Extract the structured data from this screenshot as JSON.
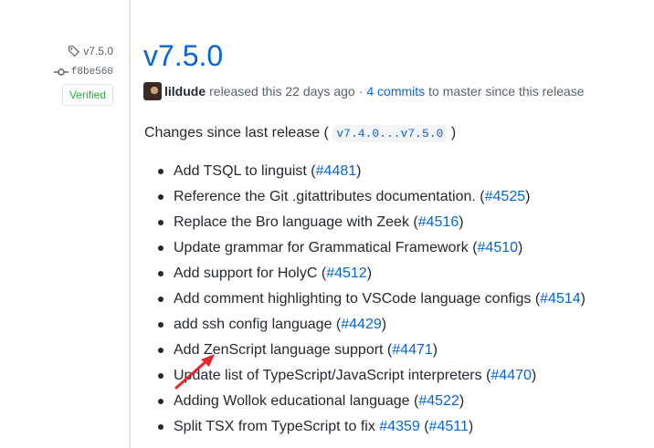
{
  "release": {
    "tag": "v7.5.0",
    "commit": "f8be560",
    "verified": "Verified",
    "title": "v7.5.0",
    "author": "lildude",
    "released_text": "released this 22 days ago",
    "separator": "·",
    "commits_link": "4 commits",
    "commits_suffix": "to master since this release",
    "changes_prefix": "Changes since last release (",
    "compare_range": "v7.4.0...v7.5.0",
    "changes_suffix": ")"
  },
  "changes": [
    {
      "text": "Add TSQL to linguist (",
      "issue": "#4481",
      "close": ")"
    },
    {
      "text": "Reference the Git .gitattributes documentation. (",
      "issue": "#4525",
      "close": ")"
    },
    {
      "text": "Replace the Bro language with Zeek (",
      "issue": "#4516",
      "close": ")"
    },
    {
      "text": "Update grammar for Grammatical Framework (",
      "issue": "#4510",
      "close": ")"
    },
    {
      "text": "Add support for HolyC (",
      "issue": "#4512",
      "close": ")"
    },
    {
      "text": "Add comment highlighting to VSCode language configs (",
      "issue": "#4514",
      "close": ")"
    },
    {
      "text": "add ssh config language (",
      "issue": "#4429",
      "close": ")"
    },
    {
      "text": "Add ZenScript language support (",
      "issue": "#4471",
      "close": ")"
    },
    {
      "text": "Update list of TypeScript/JavaScript interpreters (",
      "issue": "#4470",
      "close": ")"
    },
    {
      "text": "Adding Wollok educational language (",
      "issue": "#4522",
      "close": ")"
    },
    {
      "text": "Split TSX from TypeScript to fix ",
      "issue": "#4359",
      "mid": " (",
      "issue2": "#4511",
      "close": ")"
    }
  ],
  "icons": {
    "tag": "tag-icon",
    "commit": "git-commit-icon"
  },
  "annotation": {
    "arrow_color": "#e8262b"
  }
}
